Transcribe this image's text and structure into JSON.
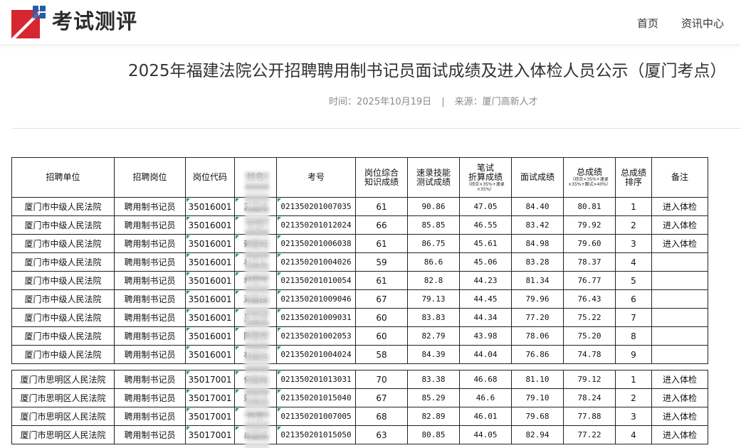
{
  "site": {
    "logo_text": "考试测评",
    "nav": [
      "首页",
      "资讯中心"
    ],
    "brand_colors": {
      "red": "#d6262f",
      "blue": "#1f5fae"
    }
  },
  "article": {
    "title": "2025年福建法院公开招聘聘用制书记员面试成绩及进入体检人员公示（厦门考点）",
    "time_label": "时间：",
    "time": "2025年10月19日",
    "source_label": "来源：",
    "source": "厦门高新人才"
  },
  "table": {
    "headers": {
      "unit": "招聘单位",
      "post": "招聘岗位",
      "code": "岗位代码",
      "name": "姓名",
      "exam_no": "考号",
      "comprehensive": "岗位综合知识成绩",
      "typing": "速录技能测试成绩",
      "written_a": "笔试",
      "written_b": "折算成绩",
      "written_note": "（综合×35%+速录×35%）",
      "interview": "面试成绩",
      "total": "总成绩",
      "total_note": "（综合×35%+速录×35%+面试×40%）",
      "rank": "总成绩排序",
      "remark": "备注"
    },
    "group1": [
      {
        "unit": "厦门市中级人民法院",
        "post": "聘用制书记员",
        "code": "35016001",
        "name": "苏▒娉",
        "exam": "021350201007035",
        "comp": "61",
        "typing": "90.86",
        "written": "47.05",
        "interview": "84.40",
        "total": "80.81",
        "rank": "1",
        "remark": "进入体检"
      },
      {
        "unit": "厦门市中级人民法院",
        "post": "聘用制书记员",
        "code": "35016001",
        "name": "曾▒i",
        "exam": "021350201012024",
        "comp": "66",
        "typing": "85.85",
        "written": "46.55",
        "interview": "83.42",
        "total": "79.92",
        "rank": "2",
        "remark": "进入体检"
      },
      {
        "unit": "厦门市中级人民法院",
        "post": "聘用制书记员",
        "code": "35016001",
        "name": "赖▒玩",
        "exam": "021350201006038",
        "comp": "61",
        "typing": "86.75",
        "written": "45.61",
        "interview": "84.98",
        "total": "79.60",
        "rank": "3",
        "remark": "进入体检"
      },
      {
        "unit": "厦门市中级人民法院",
        "post": "聘用制书记员",
        "code": "35016001",
        "name": "林▒发",
        "exam": "021350201004026",
        "comp": "59",
        "typing": "86.6",
        "written": "45.06",
        "interview": "83.28",
        "total": "78.37",
        "rank": "4",
        "remark": ""
      },
      {
        "unit": "厦门市中级人民法院",
        "post": "聘用制书记员",
        "code": "35016001",
        "name": "林▒伟",
        "exam": "021350201010054",
        "comp": "61",
        "typing": "82.8",
        "written": "44.23",
        "interview": "81.34",
        "total": "76.77",
        "rank": "5",
        "remark": ""
      },
      {
        "unit": "厦门市中级人民法院",
        "post": "聘用制书记员",
        "code": "35016001",
        "name": "邓▒日",
        "exam": "021350201009046",
        "comp": "67",
        "typing": "79.13",
        "written": "44.45",
        "interview": "79.96",
        "total": "76.43",
        "rank": "6",
        "remark": ""
      },
      {
        "unit": "厦门市中级人民法院",
        "post": "聘用制书记员",
        "code": "35016001",
        "name": "吴▒姗",
        "exam": "021350201009031",
        "comp": "60",
        "typing": "83.83",
        "written": "44.34",
        "interview": "77.20",
        "total": "75.22",
        "rank": "7",
        "remark": ""
      },
      {
        "unit": "厦门市中级人民法院",
        "post": "聘用制书记员",
        "code": "35016001",
        "name": "陈▒吉",
        "exam": "021350201002053",
        "comp": "60",
        "typing": "82.79",
        "written": "43.98",
        "interview": "78.06",
        "total": "75.20",
        "rank": "8",
        "remark": ""
      },
      {
        "unit": "厦门市中级人民法院",
        "post": "聘用制书记员",
        "code": "35016001",
        "name": "林▒听",
        "exam": "021350201004024",
        "comp": "58",
        "typing": "84.39",
        "written": "44.04",
        "interview": "76.86",
        "total": "74.78",
        "rank": "9",
        "remark": ""
      }
    ],
    "group2": [
      {
        "unit": "厦门市思明区人民法院",
        "post": "聘用制书记员",
        "code": "35017001",
        "name": "何▒晃",
        "exam": "021350201013031",
        "comp": "70",
        "typing": "83.38",
        "written": "46.68",
        "interview": "81.10",
        "total": "79.12",
        "rank": "1",
        "remark": "进入体检"
      },
      {
        "unit": "厦门市思明区人民法院",
        "post": "聘用制书记员",
        "code": "35017001",
        "name": "赖▒唠",
        "exam": "021350201015040",
        "comp": "67",
        "typing": "85.29",
        "written": "46.6",
        "interview": "79.10",
        "total": "78.24",
        "rank": "2",
        "remark": "进入体检"
      },
      {
        "unit": "厦门市思明区人民法院",
        "post": "聘用制书记员",
        "code": "35017001",
        "name": "陈▒",
        "exam": "021350201007005",
        "comp": "68",
        "typing": "82.89",
        "written": "46.01",
        "interview": "79.68",
        "total": "77.88",
        "rank": "3",
        "remark": "进入体检"
      },
      {
        "unit": "厦门市思明区人民法院",
        "post": "聘用制书记员",
        "code": "35017001",
        "name": "卓▒婷",
        "exam": "021350201015050",
        "comp": "63",
        "typing": "80.85",
        "written": "44.05",
        "interview": "82.94",
        "total": "77.22",
        "rank": "4",
        "remark": "进入体检"
      }
    ]
  }
}
